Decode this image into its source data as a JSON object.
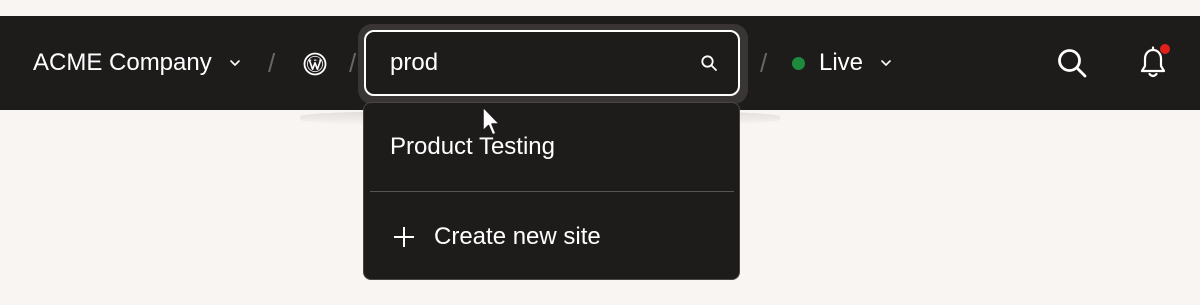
{
  "topbar": {
    "org_name": "ACME Company",
    "separator": "/",
    "platform_icon": "wordpress-icon"
  },
  "site_search": {
    "value": "prod",
    "icon": "search-icon"
  },
  "environment": {
    "label": "Live",
    "status_color": "#1e8a3c"
  },
  "actions": {
    "search_icon": "search-icon",
    "notifications_icon": "bell-icon",
    "notification_badge_color": "#e0201a"
  },
  "dropdown": {
    "results": [
      {
        "label": "Product Testing"
      }
    ],
    "create_label": "Create new site",
    "create_icon": "plus-icon"
  },
  "colors": {
    "bar_background": "#1e1b1b",
    "page_background": "#f8f5f2",
    "text": "#ffffff"
  }
}
